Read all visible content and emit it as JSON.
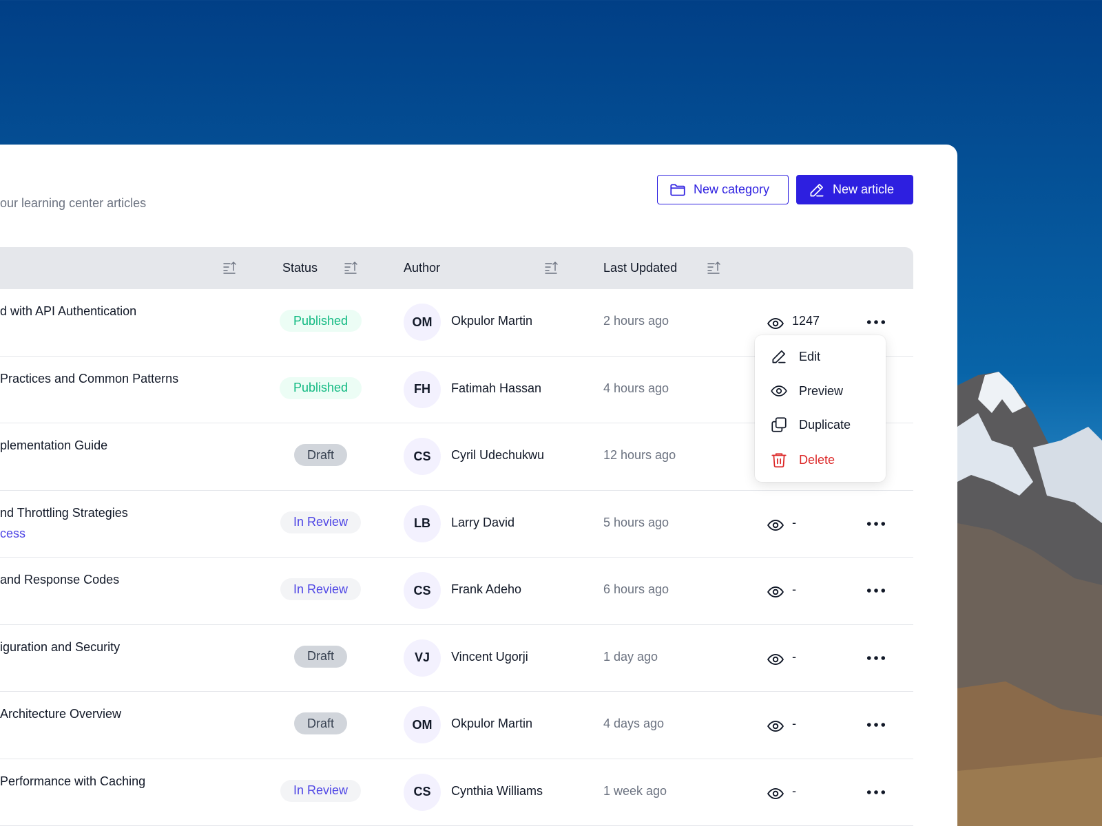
{
  "page": {
    "subtitle": "our learning center articles"
  },
  "actions": {
    "new_category": "New category",
    "new_article": "New article"
  },
  "table": {
    "headers": {
      "status": "Status",
      "author": "Author",
      "last_updated": "Last Updated"
    },
    "rows": [
      {
        "title": "d with API Authentication",
        "category": "",
        "status": "Published",
        "status_kind": "published",
        "initials": "OM",
        "author": "Okpulor Martin",
        "updated": "2 hours ago",
        "views": "1247"
      },
      {
        "title": "Practices and Common Patterns",
        "category": "",
        "status": "Published",
        "status_kind": "published",
        "initials": "FH",
        "author": "Fatimah Hassan",
        "updated": "4 hours ago",
        "views": ""
      },
      {
        "title": "plementation Guide",
        "category": "",
        "status": "Draft",
        "status_kind": "draft",
        "initials": "CS",
        "author": "Cyril Udechukwu",
        "updated": "12 hours ago",
        "views": ""
      },
      {
        "title": "nd Throttling Strategies",
        "category": "cess",
        "status": "In Review",
        "status_kind": "review",
        "initials": "LB",
        "author": "Larry David",
        "updated": "5 hours ago",
        "views": "-"
      },
      {
        "title": "and Response Codes",
        "category": "",
        "status": "In Review",
        "status_kind": "review",
        "initials": "CS",
        "author": "Frank Adeho",
        "updated": "6 hours ago",
        "views": "-"
      },
      {
        "title": "iguration and Security",
        "category": "",
        "status": "Draft",
        "status_kind": "draft",
        "initials": "VJ",
        "author": "Vincent Ugorji",
        "updated": "1 day ago",
        "views": "-"
      },
      {
        "title": "Architecture Overview",
        "category": "",
        "status": "Draft",
        "status_kind": "draft",
        "initials": "OM",
        "author": "Okpulor Martin",
        "updated": "4 days ago",
        "views": "-"
      },
      {
        "title": " Performance with Caching",
        "category": "",
        "status": "In Review",
        "status_kind": "review",
        "initials": "CS",
        "author": "Cynthia Williams",
        "updated": "1 week ago",
        "views": "-"
      }
    ]
  },
  "context_menu": {
    "edit": "Edit",
    "preview": "Preview",
    "duplicate": "Duplicate",
    "delete": "Delete"
  },
  "colors": {
    "accent": "#2d1fe0",
    "published": "#10b981",
    "review": "#4f46e5",
    "danger": "#dc2626"
  }
}
